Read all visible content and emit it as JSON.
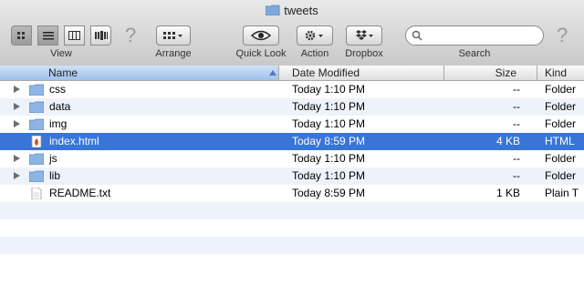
{
  "window": {
    "title": "tweets"
  },
  "toolbar": {
    "view_label": "View",
    "arrange_label": "Arrange",
    "quicklook_label": "Quick Look",
    "action_label": "Action",
    "dropbox_label": "Dropbox",
    "search_label": "Search",
    "search_placeholder": ""
  },
  "columns": {
    "name": "Name",
    "date": "Date Modified",
    "size": "Size",
    "kind": "Kind"
  },
  "files": [
    {
      "name": "css",
      "date": "Today 1:10 PM",
      "size": "--",
      "kind": "Folder",
      "type": "folder"
    },
    {
      "name": "data",
      "date": "Today 1:10 PM",
      "size": "--",
      "kind": "Folder",
      "type": "folder"
    },
    {
      "name": "img",
      "date": "Today 1:10 PM",
      "size": "--",
      "kind": "Folder",
      "type": "folder"
    },
    {
      "name": "index.html",
      "date": "Today 8:59 PM",
      "size": "4 KB",
      "kind": "HTML",
      "type": "html"
    },
    {
      "name": "js",
      "date": "Today 1:10 PM",
      "size": "--",
      "kind": "Folder",
      "type": "folder"
    },
    {
      "name": "lib",
      "date": "Today 1:10 PM",
      "size": "--",
      "kind": "Folder",
      "type": "folder"
    },
    {
      "name": "README.txt",
      "date": "Today 8:59 PM",
      "size": "1 KB",
      "kind": "Plain T",
      "type": "text"
    }
  ],
  "colors": {
    "selection": "#3875d7",
    "folder": "#8cb4e4",
    "alternate_row": "#eef3fb"
  }
}
